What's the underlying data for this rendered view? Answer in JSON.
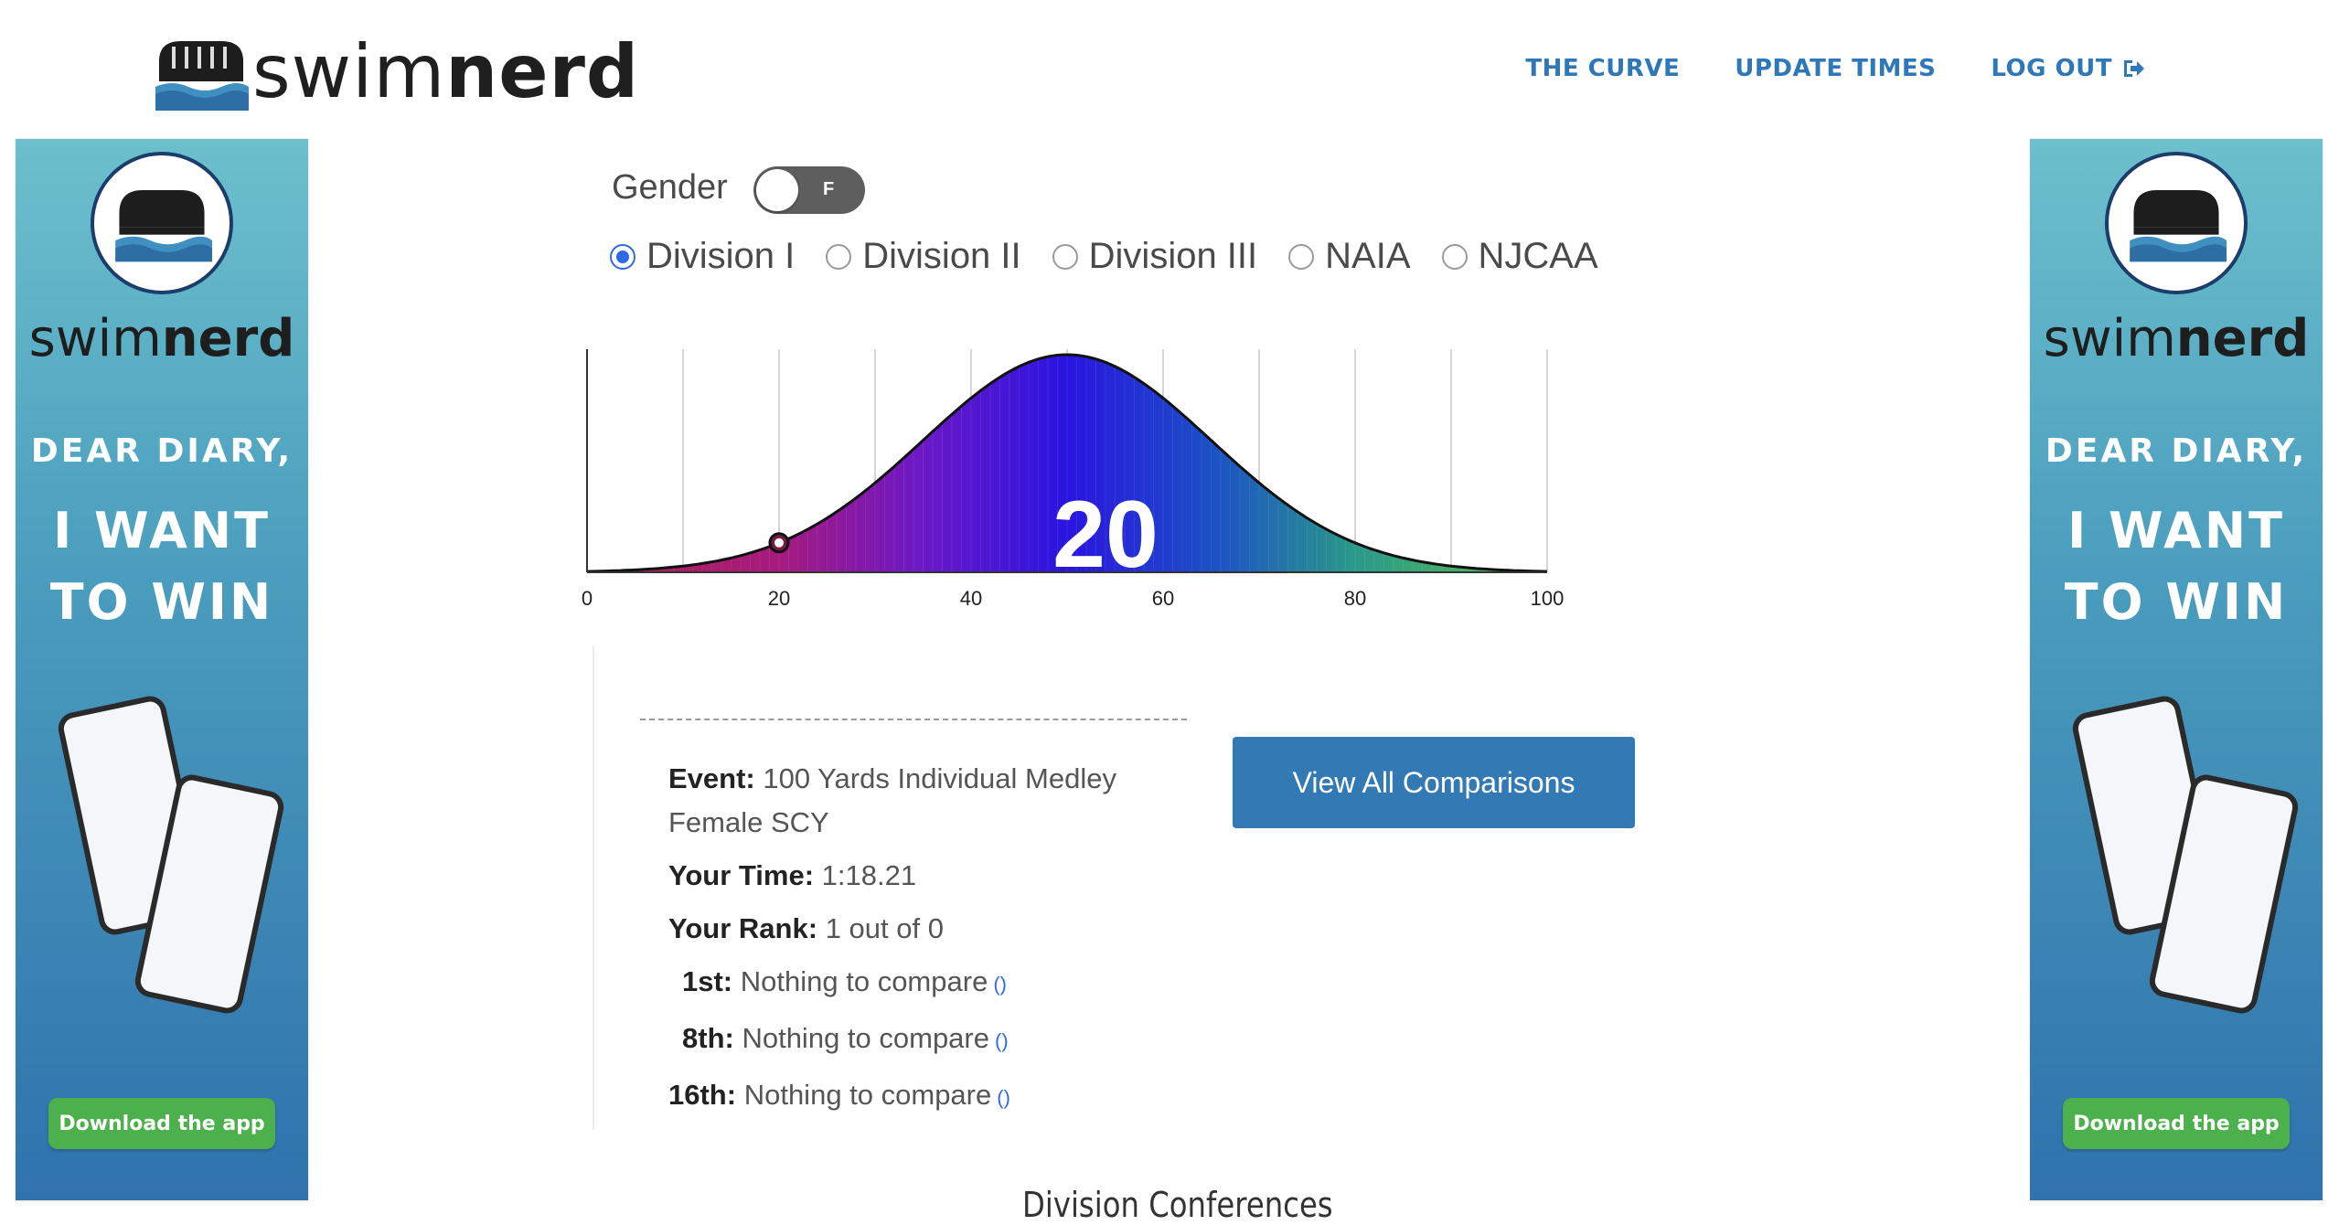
{
  "header": {
    "logo_text_light": "swim",
    "logo_text_bold": "nerd",
    "nav": [
      {
        "label": "THE CURVE"
      },
      {
        "label": "UPDATE TIMES"
      },
      {
        "label": "LOG OUT",
        "icon": "sign-out-icon"
      }
    ],
    "accent_color": "#2f78b8"
  },
  "ad": {
    "brand_light": "swim",
    "brand_bold": "nerd",
    "line1": "DEAR DIARY,",
    "line2": "I WANT",
    "line3": "TO WIN",
    "button": "Download the app"
  },
  "controls": {
    "gender_label": "Gender",
    "gender_value": "F",
    "divisions": [
      {
        "label": "Division I",
        "checked": true
      },
      {
        "label": "Division II",
        "checked": false
      },
      {
        "label": "Division III",
        "checked": false
      },
      {
        "label": "NAIA",
        "checked": false
      },
      {
        "label": "NJCAA",
        "checked": false
      }
    ]
  },
  "chart_data": {
    "type": "area",
    "x_ticks": [
      "0",
      "20",
      "40",
      "60",
      "80",
      "100"
    ],
    "xlim": [
      0,
      100
    ],
    "distribution": "normal",
    "mean": 50,
    "marker_x": 20,
    "big_label": "20",
    "grid": true
  },
  "info": {
    "event_label": "Event:",
    "event_value_line1": "100 Yards Individual Medley",
    "event_value_line2": "Female SCY",
    "time_label": "Your Time:",
    "time_value": "1:18.21",
    "rank_label": "Your Rank:",
    "rank_value": "1 out of 0",
    "places": [
      {
        "label": "1st:",
        "value": "Nothing to compare",
        "link": "()"
      },
      {
        "label": "8th:",
        "value": "Nothing to compare",
        "link": "()"
      },
      {
        "label": "16th:",
        "value": "Nothing to compare",
        "link": "()"
      }
    ],
    "compare_button": "View All Comparisons"
  },
  "section_title": "Division Conferences"
}
